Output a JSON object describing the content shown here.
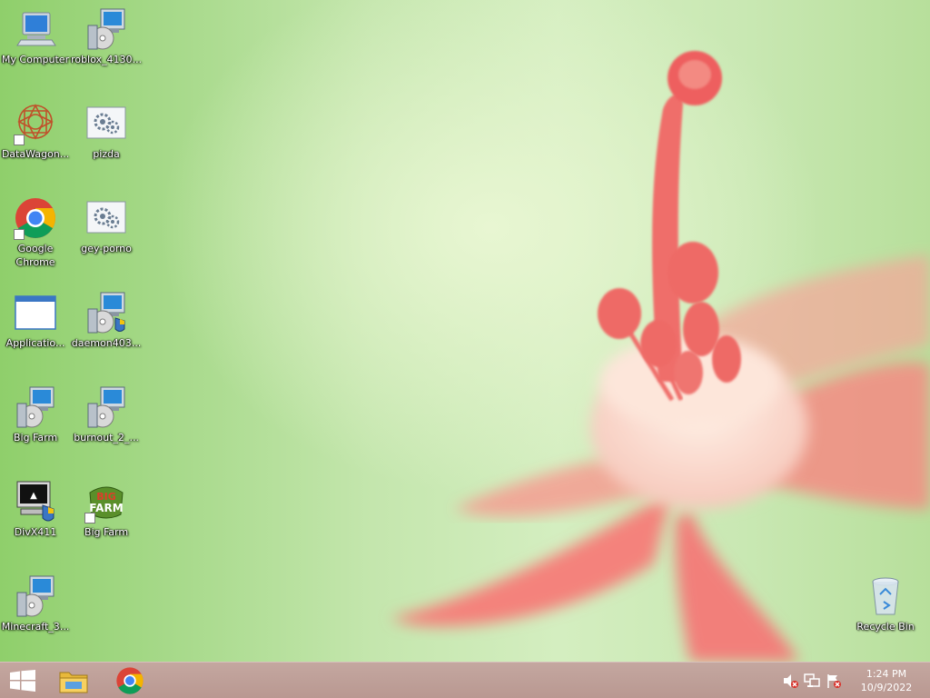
{
  "desktop": {
    "icons": [
      {
        "label": "My Computer",
        "icon": "computer-icon"
      },
      {
        "label": "roblox_4130...",
        "icon": "installer-icon"
      },
      {
        "label": "DataWagon...",
        "icon": "datawagon-icon"
      },
      {
        "label": "pizda",
        "icon": "settings-file-icon"
      },
      {
        "label": "Google Chrome",
        "icon": "chrome-icon"
      },
      {
        "label": "gey-porno",
        "icon": "settings-file-icon"
      },
      {
        "label": "Applicatio...",
        "icon": "application-window-icon"
      },
      {
        "label": "daemon403...",
        "icon": "installer-icon"
      },
      {
        "label": "Big Farm",
        "icon": "installer-icon"
      },
      {
        "label": "burnout_2_...",
        "icon": "installer-icon"
      },
      {
        "label": "DivX411",
        "icon": "divx-installer-icon"
      },
      {
        "label": "Big Farm",
        "icon": "bigfarm-icon"
      },
      {
        "label": "Minecraft_3...",
        "icon": "installer-icon"
      },
      {
        "label": "Recycle Bin",
        "icon": "recycle-bin-icon"
      }
    ]
  },
  "taskbar": {
    "start": {
      "icon": "windows-logo-icon"
    },
    "pinned": [
      {
        "icon": "file-explorer-icon"
      },
      {
        "icon": "chrome-icon"
      }
    ],
    "tray": {
      "icons": [
        "speaker-muted-icon",
        "network-icon",
        "action-center-flag-icon"
      ],
      "time": "1:24 PM",
      "date": "10/9/2022"
    }
  },
  "colors": {
    "taskbar": "#bd9e97",
    "wallpaper_green": "#a6d989",
    "flower_pink": "#f27f7a"
  }
}
